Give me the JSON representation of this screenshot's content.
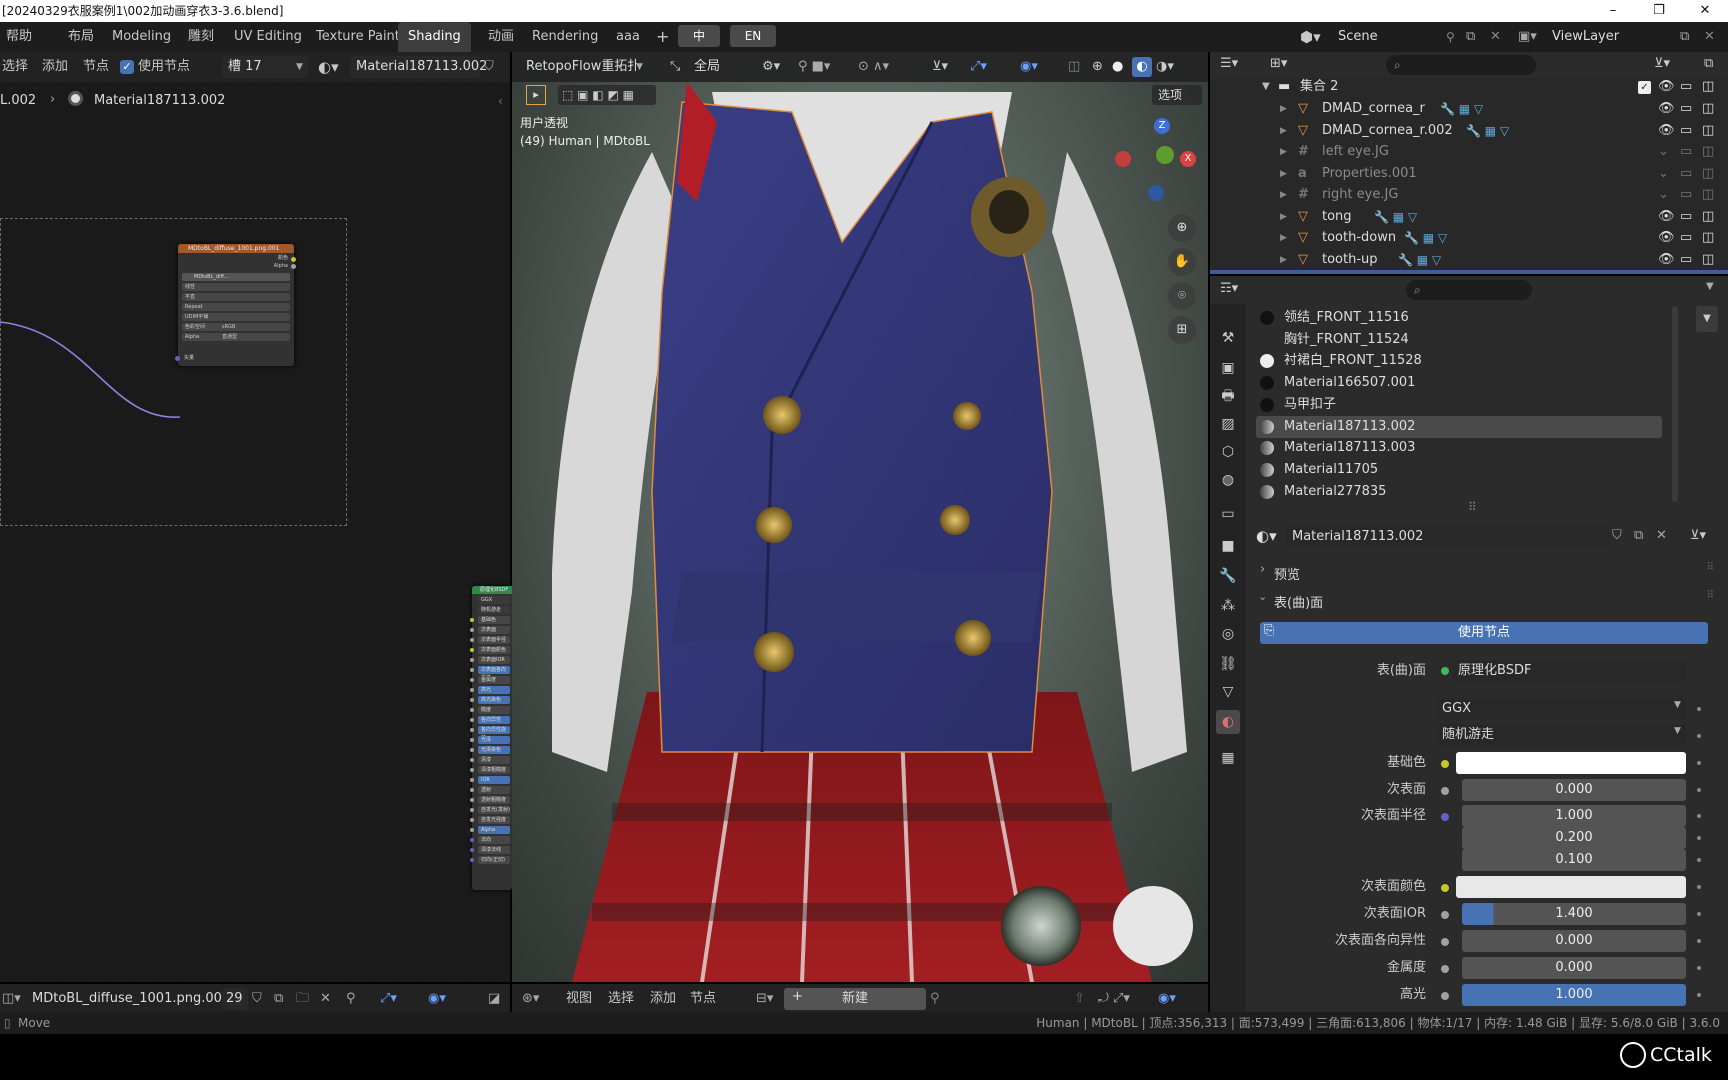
{
  "title_bar": {
    "path": "[20240329衣服案例1\\002加动画穿衣3-3.6.blend]"
  },
  "menu": {
    "help": "帮助",
    "workspaces": [
      "布局",
      "Modeling",
      "雕刻",
      "UV Editing",
      "Texture Paint",
      "Shading",
      "动画",
      "Rendering",
      "aaa"
    ],
    "active_workspace": "Shading",
    "lang_zh": "中",
    "lang_en": "EN",
    "scene": "Scene",
    "view_layer": "ViewLayer"
  },
  "node_editor": {
    "header": {
      "select": "选择",
      "add": "添加",
      "node": "节点",
      "use_nodes": "使用节点",
      "slot": "槽 17",
      "material": "Material187113.002"
    },
    "breadcrumb": {
      "object": "L.002",
      "material": "Material187113.002"
    },
    "image_node": {
      "title": "MDtoBL_diffuse_1001.png.001",
      "out_color": "颜色",
      "out_alpha": "Alpha",
      "image": "MDtoBL_diff...",
      "users": "29",
      "rows": [
        "线性",
        "平直",
        "Repeat",
        "UDIM平铺",
        "色彩空间",
        "Alpha"
      ],
      "colorspace": "sRGB",
      "alpha_mode": "直通型",
      "in_vector": "矢量"
    },
    "bsdf_node": {
      "title": "原理化BSDF",
      "rows": [
        "GGX",
        "随机游走",
        "基础色",
        "次表面",
        "次表面半径",
        "次表面颜色",
        "次表面IOR",
        "次表面各向异性",
        "金属度",
        "高光",
        "高光染色",
        "糙度",
        "各向异性",
        "各向异性旋转",
        "光泽",
        "光泽染色",
        "清漆",
        "清漆粗糙度",
        "IOR",
        "透射",
        "透射粗糙度",
        "自发光(发射)",
        "自发光强度",
        "Alpha",
        "法向",
        "清漆法线",
        "切向(正切)"
      ]
    },
    "footer": {
      "image_name": "MDtoBL_diffuse_1001.png.001",
      "users": "29"
    }
  },
  "viewport": {
    "header": {
      "retopo": "RetopoFlow重拓扑",
      "transform": "全局",
      "options": "选项"
    },
    "overlay_line1": "用户透视",
    "overlay_line2": "(49) Human | MDtoBL",
    "footer": {
      "view": "视图",
      "select": "选择",
      "add": "添加",
      "node": "节点",
      "new": "新建"
    }
  },
  "outliner": {
    "collection": "集合 2",
    "items": [
      {
        "name": "DMAD_cornea_r",
        "dim": false
      },
      {
        "name": "DMAD_cornea_r.002",
        "dim": false
      },
      {
        "name": "left eye.JG",
        "dim": true
      },
      {
        "name": "Properties.001",
        "dim": true
      },
      {
        "name": "right eye.JG",
        "dim": true
      },
      {
        "name": "tong",
        "dim": false
      },
      {
        "name": "tooth-down",
        "dim": false
      },
      {
        "name": "tooth-up",
        "dim": false
      }
    ]
  },
  "properties": {
    "materials": [
      {
        "name": "领结_FRONT_11516",
        "icon": "black"
      },
      {
        "name": "胸针_FRONT_11524",
        "icon": "none"
      },
      {
        "name": "衬裙白_FRONT_11528",
        "icon": "white"
      },
      {
        "name": "Material166507.001",
        "icon": "black"
      },
      {
        "name": "马甲扣子",
        "icon": "black"
      },
      {
        "name": "Material187113.002",
        "icon": "grey"
      },
      {
        "name": "Material187113.003",
        "icon": "grey"
      },
      {
        "name": "Material11705",
        "icon": "grey"
      },
      {
        "name": "Material277835",
        "icon": "grey"
      }
    ],
    "selected_material": "Material187113.002",
    "material_field": "Material187113.002",
    "preview_label": "预览",
    "surface_label": "表(曲)面",
    "use_nodes_button": "使用节点",
    "surface_row_label": "表(曲)面",
    "surface_value": "原理化BSDF",
    "distribution": "GGX",
    "subsurface_method": "随机游走",
    "params": [
      {
        "label": "基础色",
        "type": "color",
        "color": "#ffffff",
        "socket": "#c7c729"
      },
      {
        "label": "次表面",
        "type": "num",
        "value": "0.000",
        "socket": "#a1a1a1"
      },
      {
        "label": "次表面半径",
        "type": "num",
        "value": "1.000",
        "socket": "#6363c7"
      },
      {
        "label": "",
        "type": "num",
        "value": "0.200",
        "socket": ""
      },
      {
        "label": "",
        "type": "num",
        "value": "0.100",
        "socket": ""
      },
      {
        "label": "次表面颜色",
        "type": "color",
        "color": "#e8e8e8",
        "socket": "#c7c729"
      },
      {
        "label": "次表面IOR",
        "type": "slider",
        "value": "1.400",
        "fill": 0.14,
        "socket": "#a1a1a1"
      },
      {
        "label": "次表面各向异性",
        "type": "num",
        "value": "0.000",
        "socket": "#a1a1a1"
      },
      {
        "label": "金属度",
        "type": "num",
        "value": "0.000",
        "socket": "#a1a1a1"
      },
      {
        "label": "高光",
        "type": "slider",
        "value": "1.000",
        "fill": 1.0,
        "socket": "#a1a1a1"
      }
    ]
  },
  "status_bar": {
    "left": "Move",
    "right": "Human | MDtoBL | 顶点:356,313 | 面:573,499 | 三角面:613,806 | 物体:1/17 | 内存: 1.48 GiB | 显存: 5.6/8.0 GiB | 3.6.0"
  },
  "watermark": "CCtalk",
  "colors": {
    "accent": "#4772b3",
    "selected_row": "#334d80",
    "bg_dark": "#1d1d1d",
    "panel": "#2b2b2b"
  }
}
